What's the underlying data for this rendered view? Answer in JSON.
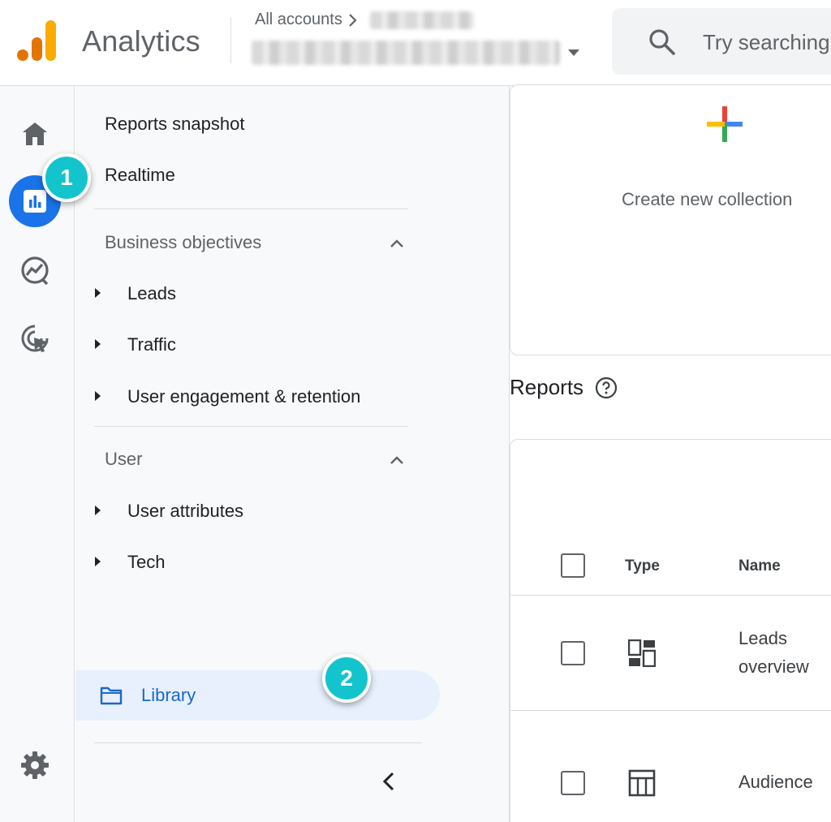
{
  "header": {
    "product_name": "Analytics",
    "breadcrumb_root": "All accounts",
    "search_placeholder": "Try searching"
  },
  "rail": {
    "items": [
      {
        "name": "Home",
        "icon": "home-icon"
      },
      {
        "name": "Reports",
        "icon": "bar-chart-icon",
        "active": true
      },
      {
        "name": "Explore",
        "icon": "explore-icon"
      },
      {
        "name": "Advertising",
        "icon": "advertising-icon"
      }
    ],
    "settings_icon": "gear-icon"
  },
  "panel": {
    "top_items": [
      "Reports snapshot",
      "Realtime"
    ],
    "sections": [
      {
        "title": "Business objectives",
        "items": [
          "Leads",
          "Traffic",
          "User engagement & retention"
        ]
      },
      {
        "title": "User",
        "items": [
          "User attributes",
          "Tech"
        ]
      }
    ],
    "library_label": "Library"
  },
  "badges": [
    "1",
    "2"
  ],
  "main": {
    "collection_label": "Create new collection",
    "reports_title": "Reports",
    "table": {
      "headers": {
        "type": "Type",
        "name": "Name"
      },
      "rows": [
        {
          "name_line1": "Leads",
          "name_line2": "overview",
          "type_icon": "overview-icon"
        },
        {
          "name_line1": "Audience",
          "name_line2": "",
          "type_icon": "detail-report-icon"
        }
      ]
    }
  },
  "colors": {
    "accent": "#1a73e8",
    "badge": "#14c4cc",
    "library_bg": "#e8f0fe",
    "panel_bg": "#f8f9fa"
  }
}
